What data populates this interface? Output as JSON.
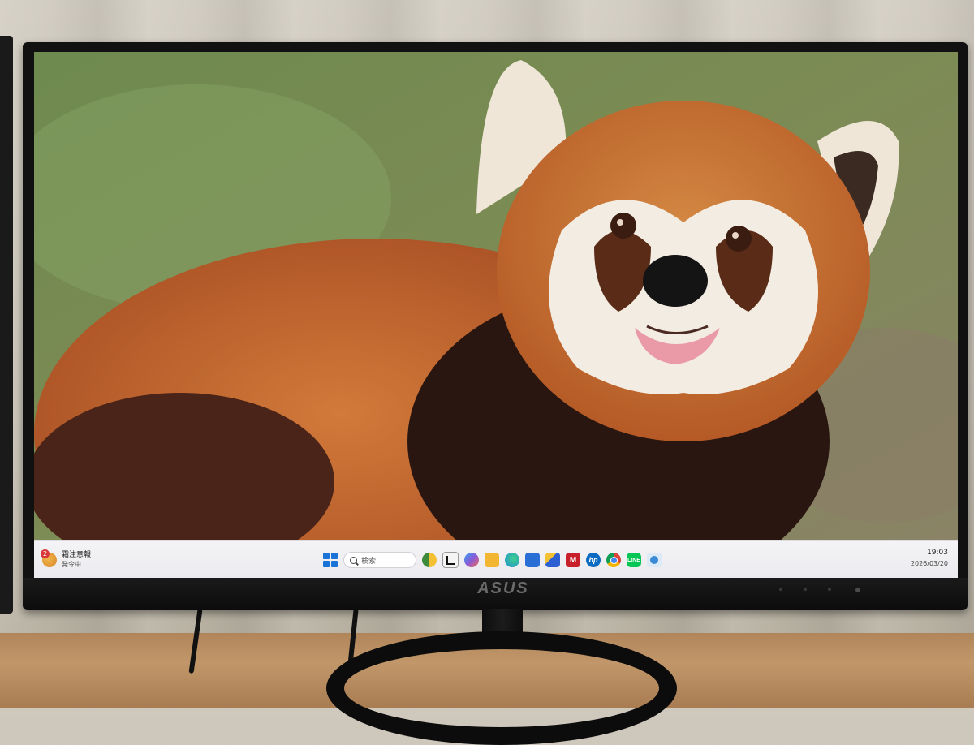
{
  "monitor": {
    "brand": "ASUS"
  },
  "taskbar": {
    "weather": {
      "icon": "weather-warning-icon",
      "badge": "2",
      "title": "霜注意報",
      "subtitle": "発令中"
    },
    "search": {
      "placeholder": "検索"
    },
    "pinned_apps": [
      {
        "name": "start-menu",
        "icon": "windows-start-icon"
      },
      {
        "name": "widgets",
        "icon": "widgets-icon",
        "color": "#3c8a3a"
      },
      {
        "name": "task-view",
        "icon": "task-view-icon",
        "color": "#1b1b1b"
      },
      {
        "name": "copilot",
        "icon": "copilot-icon",
        "color": "#8a5bd6"
      },
      {
        "name": "file-explorer",
        "icon": "folder-icon",
        "color": "#f2b632"
      },
      {
        "name": "edge",
        "icon": "edge-icon",
        "color": "#1f8fd1"
      },
      {
        "name": "store",
        "icon": "store-icon",
        "color": "#2a6fd6"
      },
      {
        "name": "app-blue",
        "icon": "blue-app-icon",
        "color": "#2c5fd1"
      },
      {
        "name": "mcafee",
        "icon": "mcafee-icon",
        "color": "#c8202a"
      },
      {
        "name": "hp",
        "icon": "hp-icon",
        "color": "#0a6bc1",
        "label": "hp"
      },
      {
        "name": "chrome",
        "icon": "chrome-icon",
        "color": "#db4437"
      },
      {
        "name": "line",
        "icon": "line-icon",
        "color": "#06c755"
      },
      {
        "name": "app-last",
        "icon": "network-app-icon",
        "color": "#3a8ad6"
      }
    ],
    "clock": {
      "time": "19:03",
      "date": "2026/03/20"
    }
  }
}
